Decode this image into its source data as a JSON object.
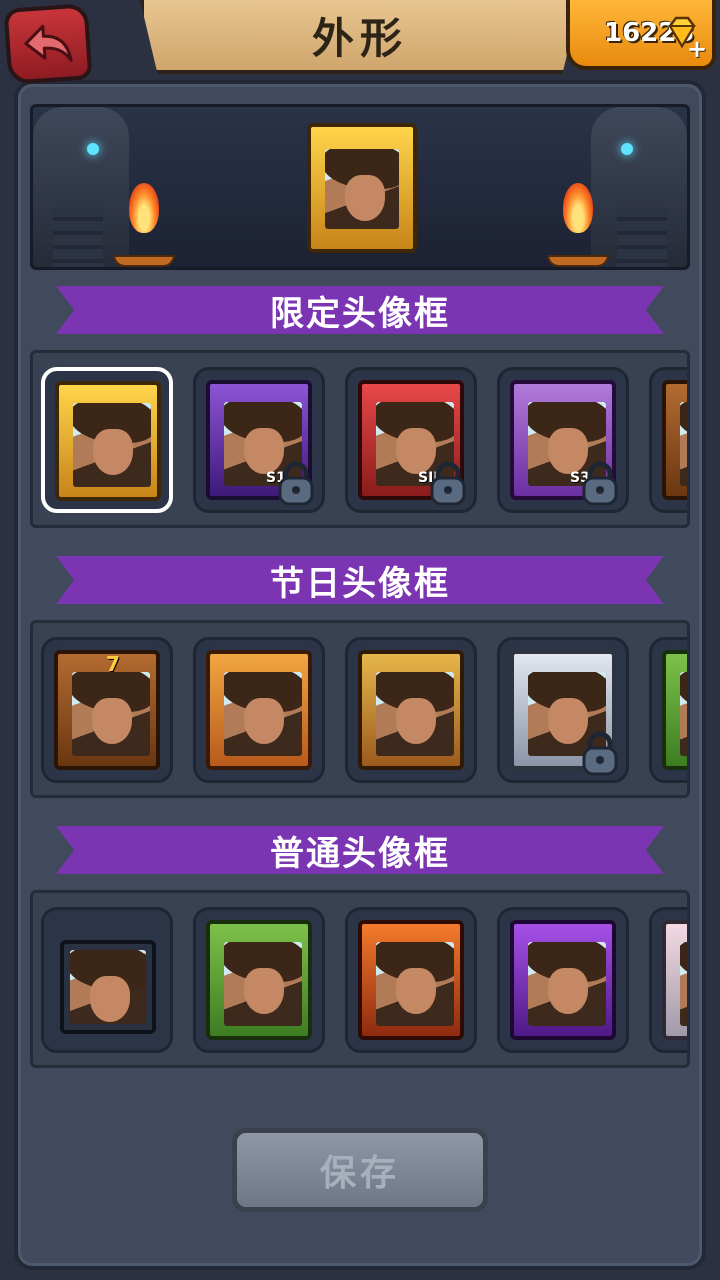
{
  "header": {
    "title": "外形",
    "gem_count": "16223",
    "back_icon": "back-arrow-icon",
    "gem_icon": "diamond-icon"
  },
  "sections": [
    {
      "title": "限定头像框",
      "items": [
        {
          "name": "golden-frame",
          "badge": "",
          "locked": false,
          "selected": true
        },
        {
          "name": "purple-winged-frame",
          "badge": "S1",
          "locked": true,
          "selected": false
        },
        {
          "name": "red-horned-frame",
          "badge": "SII",
          "locked": true,
          "selected": false
        },
        {
          "name": "violet-chest-frame",
          "badge": "S3",
          "locked": true,
          "selected": false
        },
        {
          "name": "feather-frame",
          "badge": "",
          "locked": false,
          "selected": false
        }
      ]
    },
    {
      "title": "节日头像框",
      "items": [
        {
          "name": "lucky-seven-frame",
          "badge": "7",
          "locked": false,
          "selected": false
        },
        {
          "name": "dog-lantern-frame",
          "badge": "",
          "locked": false,
          "selected": false
        },
        {
          "name": "goat-frame",
          "badge": "",
          "locked": false,
          "selected": false
        },
        {
          "name": "bunny-frame",
          "badge": "",
          "locked": true,
          "selected": false
        },
        {
          "name": "christmas-frame",
          "badge": "",
          "locked": false,
          "selected": false
        }
      ]
    },
    {
      "title": "普通头像框",
      "items": [
        {
          "name": "plain-frame",
          "badge": "",
          "locked": false,
          "selected": false
        },
        {
          "name": "vine-frame",
          "badge": "",
          "locked": false,
          "selected": false
        },
        {
          "name": "fire-frame",
          "badge": "",
          "locked": false,
          "selected": false
        },
        {
          "name": "amethyst-frame",
          "badge": "",
          "locked": false,
          "selected": false
        },
        {
          "name": "sakura-frame",
          "badge": "",
          "locked": false,
          "selected": false
        }
      ]
    }
  ],
  "save_button": "保存",
  "colors": {
    "section_banner": "#7b35b3",
    "panel": "#414a5c",
    "gem_box": "#f0a020",
    "back_button": "#b42a30"
  }
}
